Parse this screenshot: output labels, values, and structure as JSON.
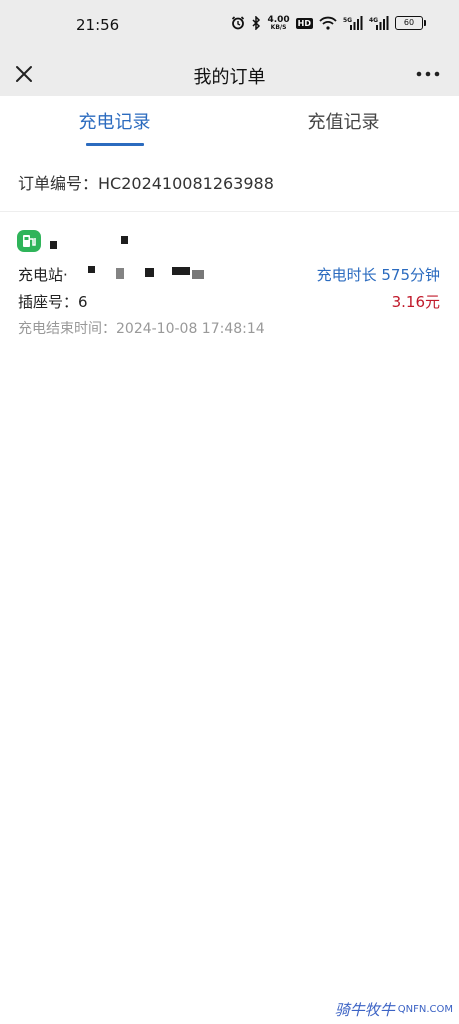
{
  "statusbar": {
    "time": "21:56",
    "speed_value": "4.00",
    "speed_unit": "KB/S",
    "hd_label": "HD",
    "signal1_label": "5G",
    "signal2_label": "4G",
    "battery": "60"
  },
  "nav": {
    "title": "我的订单"
  },
  "tabs": [
    {
      "label": "充电记录",
      "active": true
    },
    {
      "label": "充值记录",
      "active": false
    }
  ],
  "order": {
    "number_label": "订单编号：HC202410081263988",
    "station_label": "充电站·",
    "duration": "充电时长 575分钟",
    "socket": "插座号：6",
    "price": "3.16元",
    "end_time": "充电结束时间：2024-10-08 17:48:14"
  },
  "watermark": {
    "cn": "骑牛牧牛",
    "en": "QNFN.COM"
  },
  "colors": {
    "accent": "#2b6bbf",
    "price": "#c0192a",
    "icon_green": "#2fb45a"
  }
}
